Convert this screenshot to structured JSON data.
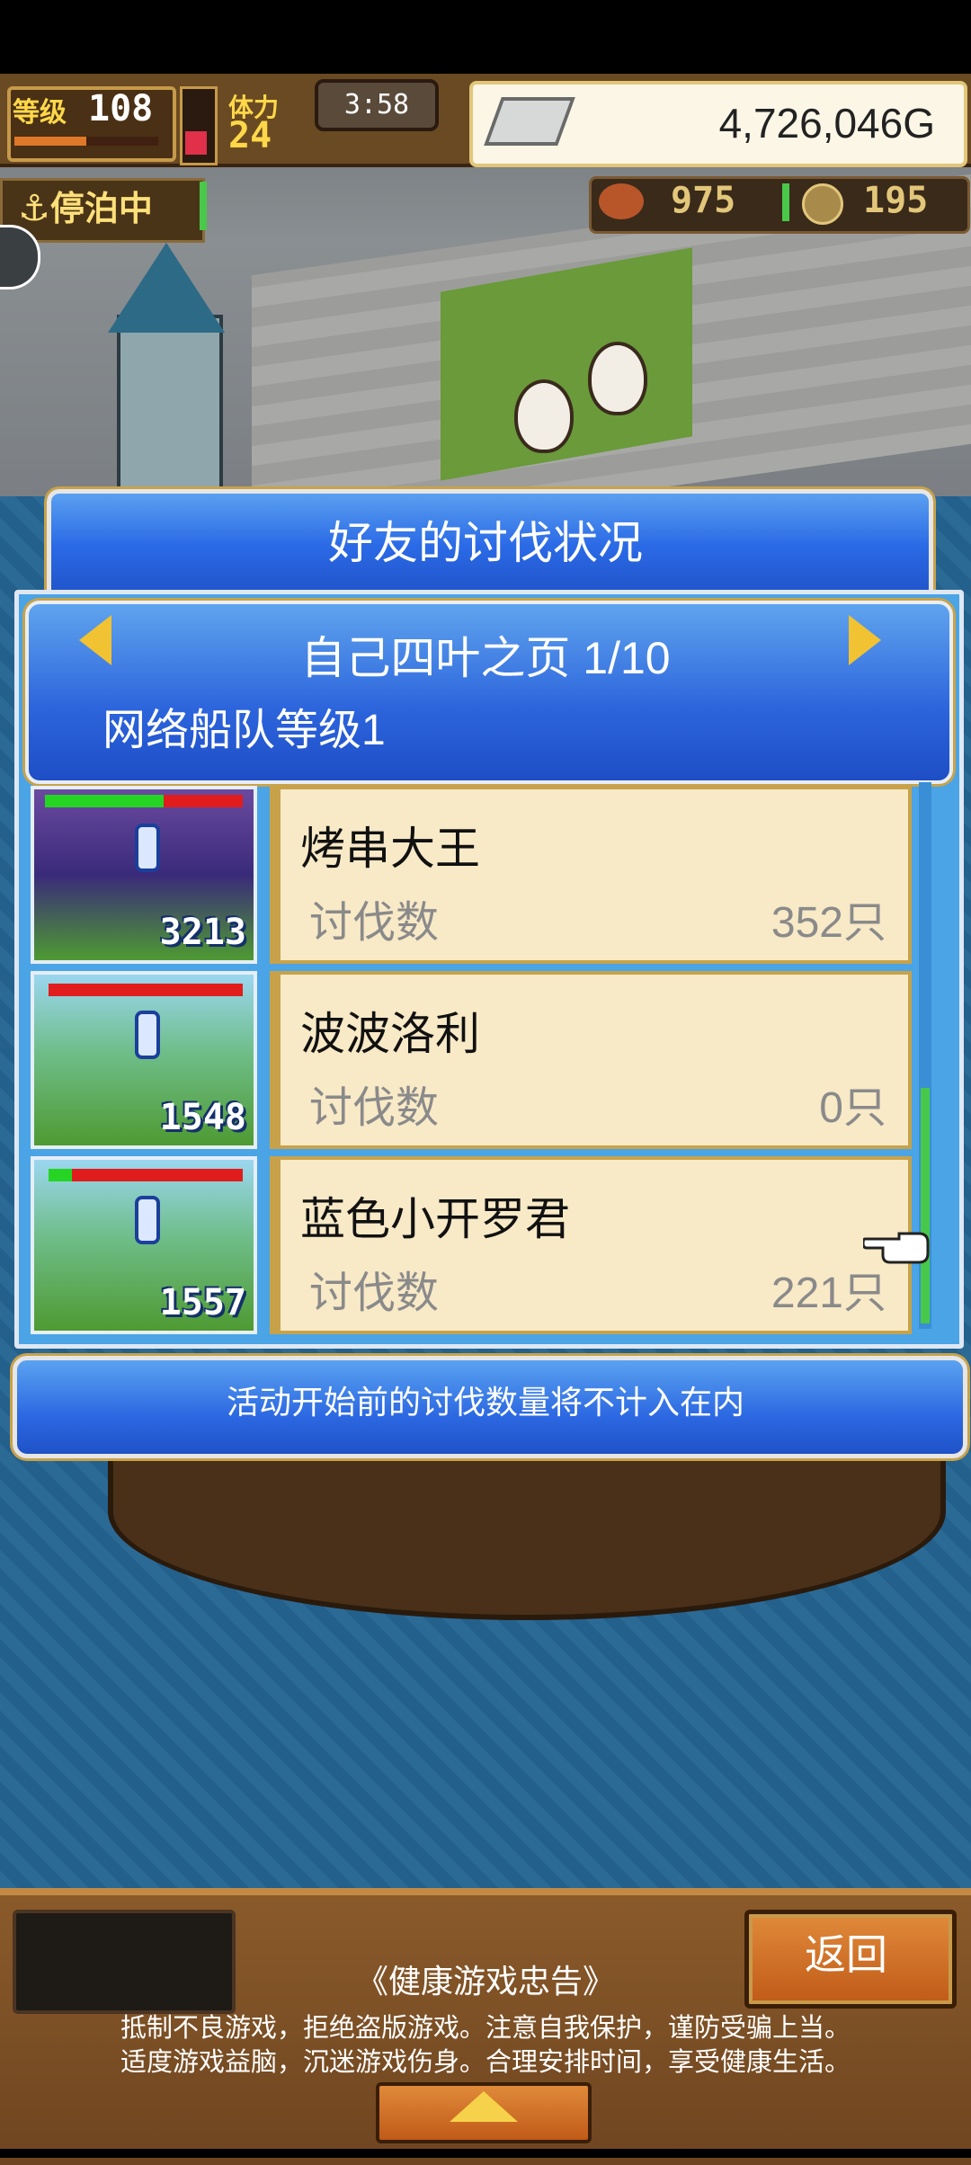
{
  "hud": {
    "level_label": "等级",
    "level_value": "108",
    "stamina_label": "体力",
    "stamina_value": "24",
    "timer": "3:58",
    "money": "4,726,046G",
    "resource_1": "975",
    "resource_2": "195",
    "anchor_status": "停泊中"
  },
  "dialog": {
    "title": "好友的讨伐状况",
    "page_title": "自己四叶之页 1/10",
    "page_subtitle": "网络船队等级1",
    "rows": [
      {
        "name": "烤串大王",
        "label": "讨伐数",
        "count": "352只",
        "thumb_number": "3213",
        "hp_fraction": 0.6
      },
      {
        "name": "波波洛利",
        "label": "讨伐数",
        "count": "0只",
        "thumb_number": "1548",
        "hp_fraction": 0.0
      },
      {
        "name": "蓝色小开罗君",
        "label": "讨伐数",
        "count": "221只",
        "thumb_number": "1557",
        "hp_fraction": 0.12
      }
    ],
    "notice": "活动开始前的讨伐数量将不计入在内"
  },
  "bottom": {
    "back_label": "返回",
    "health_title": "《健康游戏忠告》",
    "health_line_1": "抵制不良游戏，拒绝盗版游戏。注意自我保护，谨防受骗上当。",
    "health_line_2": "适度游戏益脑，沉迷游戏伤身。合理安排时间，享受健康生活。"
  },
  "colors": {
    "accent_blue": "#2c68e2",
    "gold": "#c8a24a",
    "card_bg": "#f8e9c7"
  }
}
